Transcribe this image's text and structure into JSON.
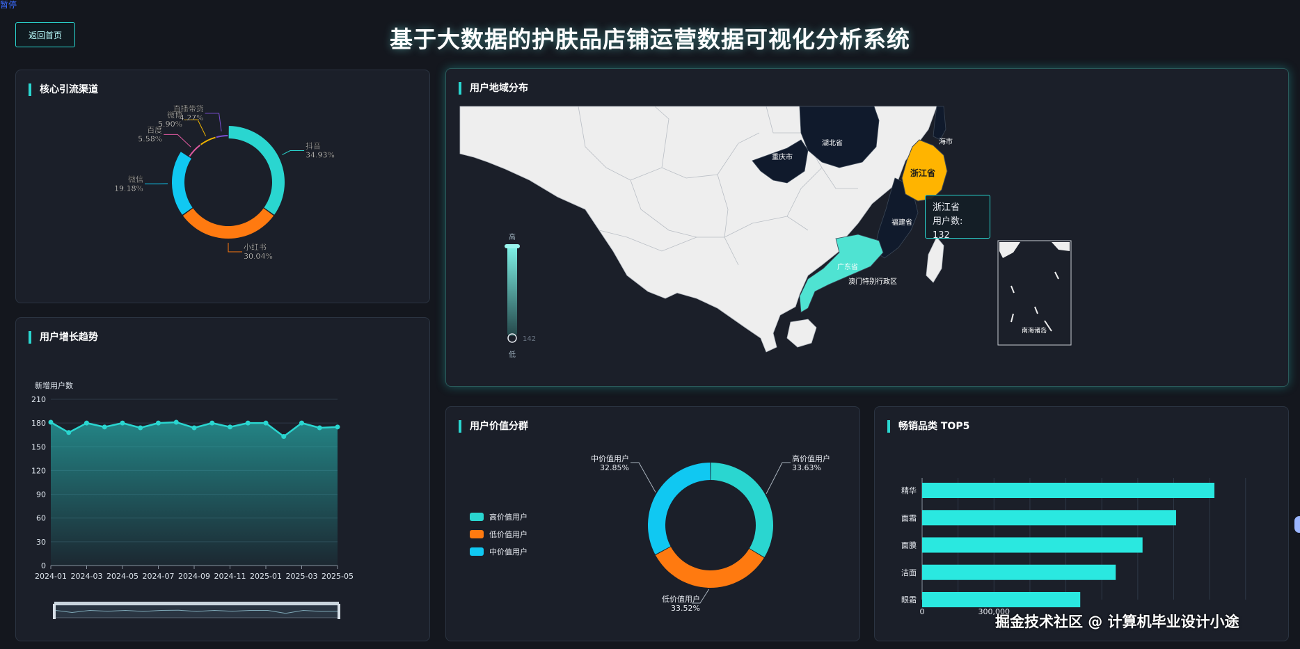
{
  "page": {
    "corner_label": "暂停",
    "back_label": "返回首页",
    "title": "基于大数据的护肤品店铺运营数据可视化分析系统"
  },
  "panels": {
    "channels": "核心引流渠道",
    "growth": "用户增长趋势",
    "map": "用户地域分布",
    "segments": "用户价值分群",
    "top5": "畅销品类 TOP5"
  },
  "colors": {
    "accent": "#2ad6d0",
    "orange": "#ff7a10",
    "blue": "#10c8f2",
    "highlight": "#ffb400",
    "pink": "#e05aa0",
    "purple": "#7a4fd0",
    "yellow": "#f0b400"
  },
  "chart_data": [
    {
      "id": "channels",
      "type": "pie",
      "slices": [
        {
          "name": "抖音",
          "pct_label": "34.93%",
          "value": 34.93,
          "color": "#2ad6d0"
        },
        {
          "name": "小红书",
          "pct_label": "30.04%",
          "value": 30.04,
          "color": "#ff7a10"
        },
        {
          "name": "微信",
          "pct_label": "19.18%",
          "value": 19.18,
          "color": "#10c8f2"
        },
        {
          "name": "百度",
          "pct_label": "5.58%",
          "value": 5.58,
          "color": "#e05aa0"
        },
        {
          "name": "微博",
          "pct_label": "5.90%",
          "value": 5.9,
          "color": "#f0b400"
        },
        {
          "name": "直播带货",
          "pct_label": "4.27%",
          "value": 4.27,
          "color": "#7a4fd0"
        }
      ]
    },
    {
      "id": "growth",
      "type": "area",
      "ylabel": "新增用户数",
      "ylim": [
        0,
        210
      ],
      "yticks": [
        "0",
        "30",
        "60",
        "90",
        "120",
        "150",
        "180",
        "210"
      ],
      "xticks": [
        "2024-01",
        "2024-03",
        "2024-05",
        "2024-07",
        "2024-09",
        "2024-11",
        "2025-01",
        "2025-03",
        "2025-05"
      ],
      "x": [
        "2024-01",
        "2024-02",
        "2024-03",
        "2024-04",
        "2024-05",
        "2024-06",
        "2024-07",
        "2024-08",
        "2024-09",
        "2024-10",
        "2024-11",
        "2024-12",
        "2025-01",
        "2025-02",
        "2025-03",
        "2025-04",
        "2025-05"
      ],
      "values": [
        181,
        168,
        180,
        175,
        180,
        174,
        180,
        181,
        174,
        180,
        175,
        180,
        180,
        163,
        180,
        174,
        175
      ],
      "grid": true
    },
    {
      "id": "map",
      "type": "map",
      "scale_labels": {
        "high": "高",
        "low": "低",
        "min_value": "142"
      },
      "regions": [
        {
          "name": "浙江省",
          "value": 132
        },
        {
          "name": "湖北省"
        },
        {
          "name": "重庆市"
        },
        {
          "name": "福建省"
        },
        {
          "name": "广东省"
        },
        {
          "name": "海市"
        },
        {
          "name": "南海诸岛"
        },
        {
          "name": "澳门特别行政区"
        }
      ],
      "tooltip": {
        "title": "浙江省",
        "label": "用户数:",
        "value": "132"
      }
    },
    {
      "id": "segments",
      "type": "pie",
      "slices": [
        {
          "name": "高价值用户",
          "pct_label": "33.63%",
          "value": 33.63,
          "color": "#2ad6d0"
        },
        {
          "name": "低价值用户",
          "pct_label": "33.52%",
          "value": 33.52,
          "color": "#ff7a10"
        },
        {
          "name": "中价值用户",
          "pct_label": "32.85%",
          "value": 32.85,
          "color": "#10c8f2"
        }
      ],
      "legend": [
        "高价值用户",
        "低价值用户",
        "中价值用户"
      ]
    },
    {
      "id": "top5",
      "type": "bar",
      "orientation": "horizontal",
      "categories": [
        "精华",
        "面霜",
        "面膜",
        "洁面",
        "眼霜"
      ],
      "values": [
        1220000,
        1060000,
        920000,
        808000,
        660000
      ],
      "xlim": [
        0,
        1400000
      ],
      "xticks": [
        "0",
        "300,000"
      ],
      "color": "#2ae8e0"
    }
  ],
  "watermark": "掘金技术社区 @ 计算机毕业设计小途"
}
